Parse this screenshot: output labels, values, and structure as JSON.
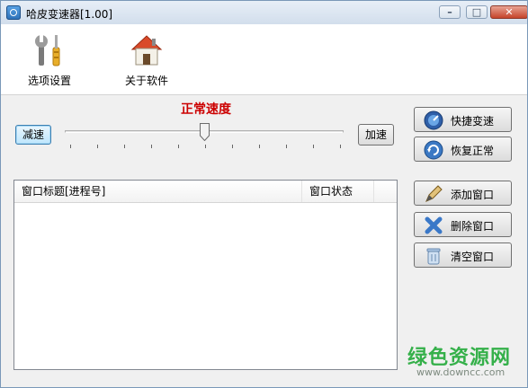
{
  "window": {
    "title": "哈皮变速器[1.00]",
    "controls": [
      "minimize-icon",
      "maximize-icon",
      "close-icon"
    ]
  },
  "toolbar": {
    "items": [
      {
        "label": "选项设置",
        "icon": "tools-icon"
      },
      {
        "label": "关于软件",
        "icon": "house-icon"
      }
    ]
  },
  "speed": {
    "status_label": "正常速度",
    "status_color": "#cc0000",
    "decrease_label": "减速",
    "increase_label": "加速",
    "slider_position": 0.5
  },
  "actions": {
    "quick_speed_label": "快捷变速",
    "restore_normal_label": "恢复正常",
    "add_window_label": "添加窗口",
    "delete_window_label": "删除窗口",
    "clear_window_label": "清空窗口"
  },
  "list": {
    "columns": [
      "窗口标题[进程号]",
      "窗口状态"
    ],
    "rows": []
  },
  "watermark": {
    "main": "绿色资源网",
    "sub": "www.downcc.com",
    "color": "#35b04a"
  }
}
